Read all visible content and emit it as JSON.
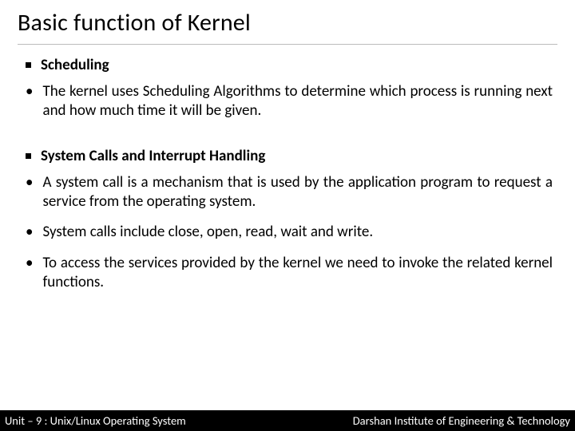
{
  "title": "Basic function of Kernel",
  "sections": [
    {
      "heading": "Scheduling",
      "bullets": [
        "The kernel uses Scheduling Algorithms to determine which process is running next and how much time it will be given."
      ]
    },
    {
      "heading": "System Calls and Interrupt Handling",
      "bullets": [
        "A system call is a mechanism that is used by the application program to request a service from the operating system.",
        "System calls include close, open, read, wait and write.",
        "To access the services provided by the kernel we need to invoke the related kernel functions."
      ]
    }
  ],
  "footer": {
    "left": "Unit – 9  : Unix/Linux Operating System",
    "right": "Darshan Institute of Engineering & Technology"
  }
}
